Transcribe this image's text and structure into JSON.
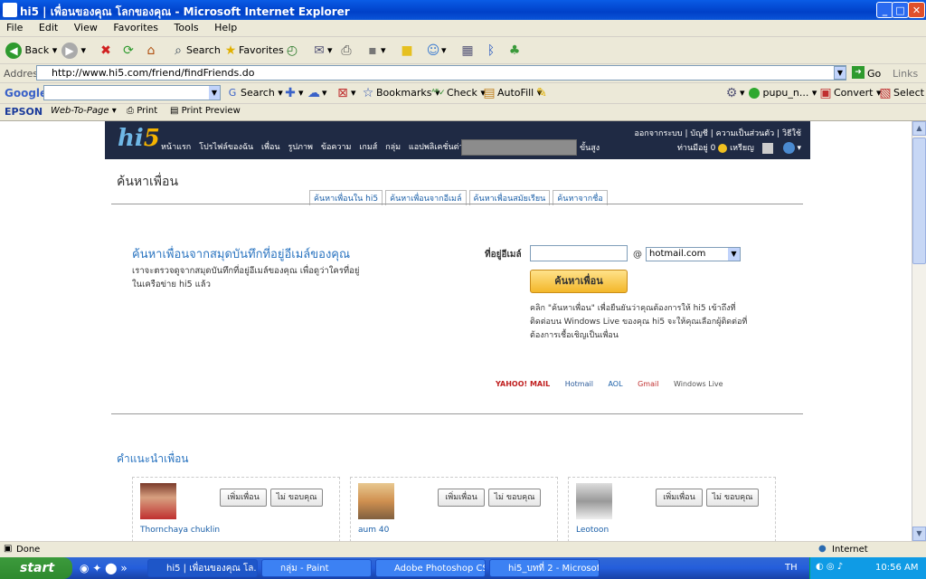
{
  "window": {
    "title": "hi5 | เพื่อนของคุณ โลกของคุณ - Microsoft Internet Explorer"
  },
  "menu": [
    "File",
    "Edit",
    "View",
    "Favorites",
    "Tools",
    "Help"
  ],
  "toolbar": {
    "back": "Back",
    "search": "Search",
    "favorites": "Favorites"
  },
  "address": {
    "label": "Address",
    "url": "http://www.hi5.com/friend/findFriends.do",
    "go": "Go",
    "links": "Links"
  },
  "googlebar": {
    "brand": "Google",
    "search": "Search",
    "bookmarks": "Bookmarks",
    "check": "Check",
    "autofill": "AutoFill",
    "user": "pupu_n...",
    "convert": "Convert",
    "select": "Select"
  },
  "epson": {
    "brand": "EPSON",
    "webtopage": "Web-To-Page",
    "print": "Print",
    "preview": "Print Preview"
  },
  "hi5": {
    "logo_hi": "hi",
    "logo_5": "5",
    "nav": [
      "หน้าแรก",
      "โปรไฟล์ของฉัน",
      "เพื่อน",
      "รูปภาพ",
      "ข้อความ",
      "เกมส์",
      "กลุ่ม",
      "แอปพลิเคชั่นต่างๆ"
    ],
    "advanced": "ขั้นสูง",
    "top_links": "ออกจากระบบ | บัญชี | ความเป็นส่วนตัว | วิธีใช้",
    "coins": "ท่านมีอยู่ 0",
    "coins_label": "เหรียญ"
  },
  "page": {
    "title": "ค้นหาเพื่อน",
    "tabs": [
      "ค้นหาเพื่อนใน hi5",
      "ค้นหาเพื่อนจากอีเมล์",
      "ค้นหาเพื่อนสมัยเรียน",
      "ค้นหาจากชื่อ"
    ],
    "heading": "ค้นหาเพื่อนจากสมุดบันทึกที่อยู่อีเมล์ของคุณ",
    "description": "เราจะตรวจดูจากสมุดบันทึกที่อยู่อีเมล์ของคุณ เพื่อดูว่าใครที่อยู่ในเครือข่าย hi5 แล้ว",
    "email_label": "ที่อยู่อีเมล์",
    "email_value": "",
    "at": "@",
    "domain": "hotmail.com",
    "find_button": "ค้นหาเพื่อน",
    "note": "คลิก \"ค้นหาเพื่อน\" เพื่อยืนยันว่าคุณต้องการให้ hi5 เข้าถึงที่ติดต่อบน Windows Live ของคุณ hi5 จะให้คุณเลือกผู้ติดต่อที่ต้องการเชื้อเชิญเป็นเพื่อน",
    "providers": [
      "YAHOO! MAIL",
      "Hotmail",
      "AOL",
      "Gmail",
      "Windows Live"
    ]
  },
  "suggestions": {
    "title": "คำแนะนำเพื่อน",
    "add_label": "เพิ่มเพื่อน",
    "no_label": "ไม่ ขอบคุณ",
    "people": [
      {
        "name": "Thornchaya chuklin"
      },
      {
        "name": "aum 40"
      },
      {
        "name": "Leotoon"
      }
    ]
  },
  "status": {
    "text": "Done",
    "zone": "Internet"
  },
  "taskbar": {
    "start": "start",
    "tasks": [
      "hi5 | เพื่อนของคุณ โล...",
      "กลุ่ม - Paint",
      "Adobe Photoshop CS...",
      "hi5_บทที่ 2 - Microsof..."
    ],
    "lang": "TH",
    "time": "10:56 AM"
  }
}
